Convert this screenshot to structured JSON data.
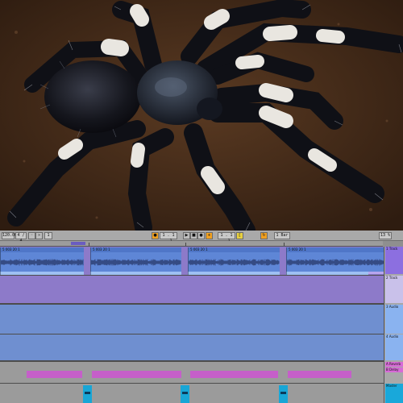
{
  "photo": {
    "subject": "tarantula",
    "background_color": "#4a2e1b"
  },
  "transport": {
    "tempo": "120.00",
    "signature": "4 / 4",
    "position": "1 . 1 . 1",
    "zoom": "1 Bar",
    "cpu": "13 %",
    "play_label": "▶",
    "stop_label": "■",
    "record_label": "●"
  },
  "tracks": [
    {
      "name": "1 Track",
      "clip_label": "Track 4c 7504",
      "color": "#b7a5ee"
    },
    {
      "name": "2 Track",
      "clip_label": "Track 4c 7504",
      "color": "#b7a5ee"
    },
    {
      "name": "3 Audio",
      "clip_label": "3 003 20 1",
      "color": "#9ec0f3"
    },
    {
      "name": "4 Audio",
      "clip_label": "5 003 20 1",
      "color": "#5e86d6"
    },
    {
      "name": "5 MIDI",
      "clip_label": "",
      "color": "#9b9b9b"
    },
    {
      "name": "6 MIDI",
      "clip_label": "",
      "color": "#9b9b9b"
    }
  ],
  "side_panel": [
    {
      "label": "1 Track",
      "color": "purple"
    },
    {
      "label": "2 Track",
      "color": "light"
    },
    {
      "label": "3 Audio",
      "color": "blue"
    },
    {
      "label": "4 Audio",
      "color": "blue"
    },
    {
      "label": "A Reverb",
      "color": "pink"
    },
    {
      "label": "B Delay",
      "color": "pink"
    },
    {
      "label": "Master",
      "color": "cyan"
    }
  ],
  "colors": {
    "accent_orange": "#f0a020",
    "purple_lane": "#8d7ac9",
    "blue_lane": "#6f8fd0",
    "pink": "#c55fc9",
    "cyan": "#18a6d6"
  }
}
